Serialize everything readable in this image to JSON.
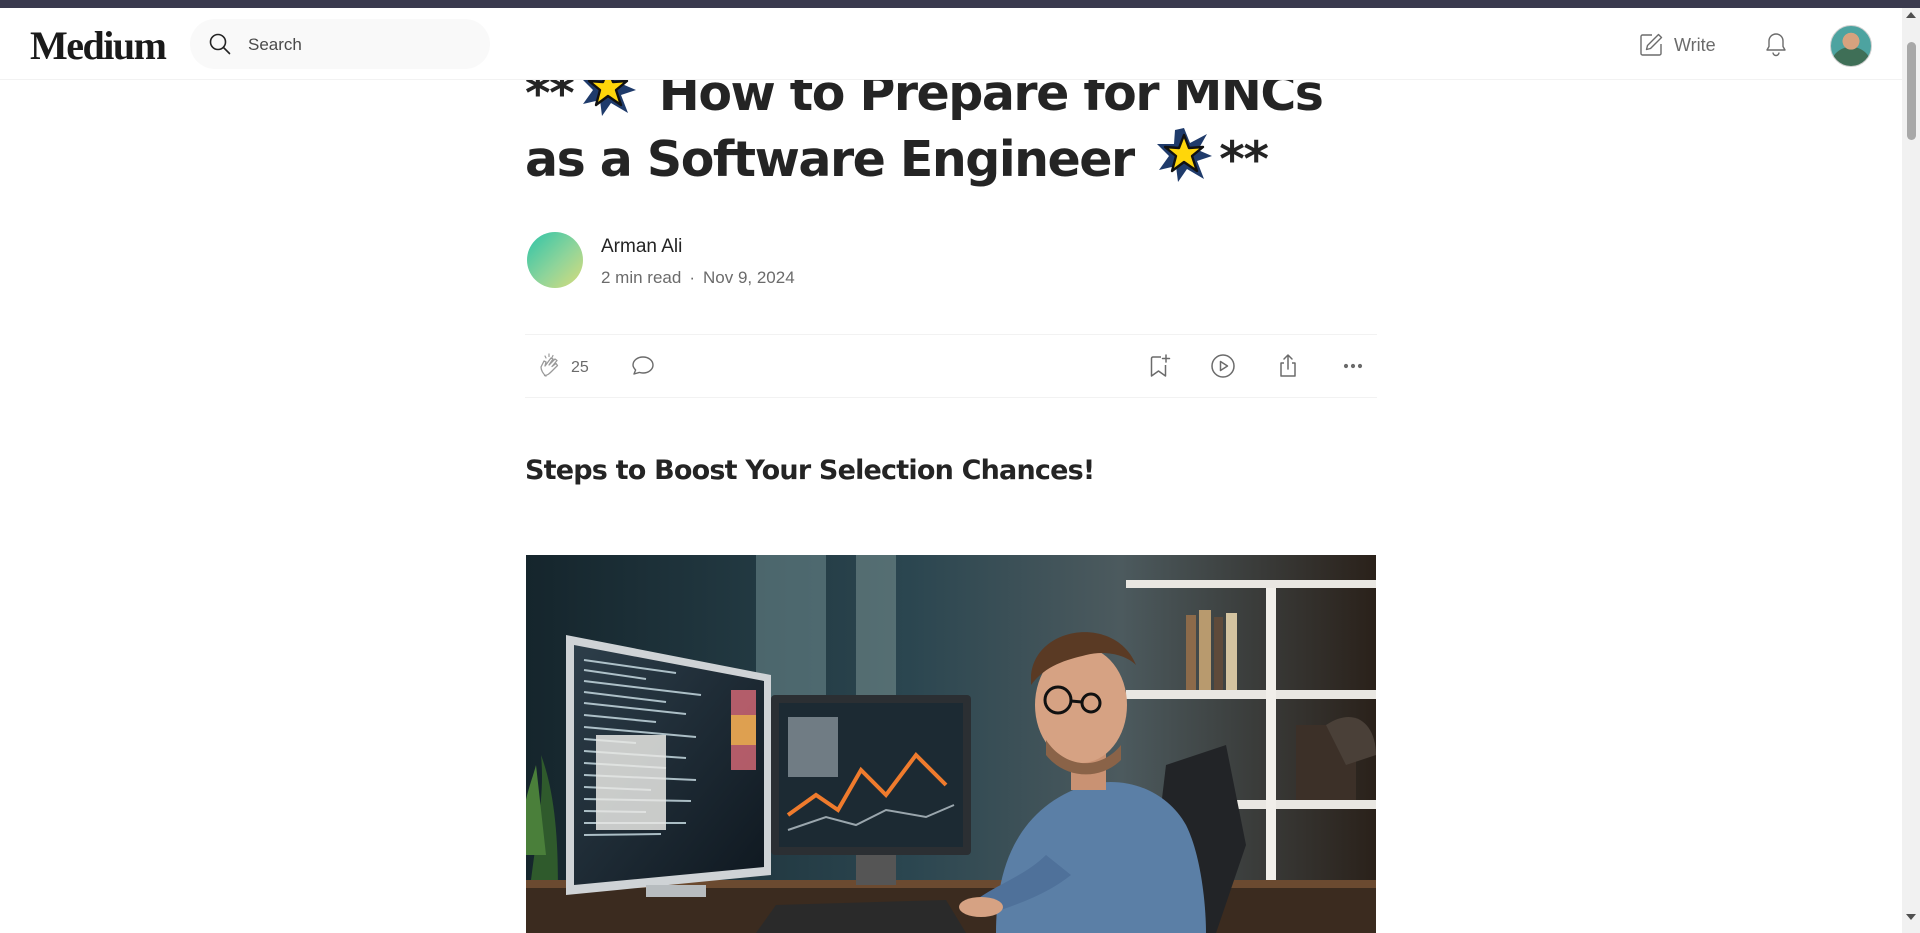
{
  "header": {
    "logo": "Medium",
    "search_placeholder": "Search",
    "write_label": "Write",
    "icons": {
      "search": "search-icon",
      "write": "write-icon",
      "notifications": "bell-icon",
      "avatar": "user-avatar"
    }
  },
  "article": {
    "title_prefix": "**",
    "title_text": "How to Prepare for MNCs as a Software Engineer",
    "title_suffix": "**",
    "title_emoji": "glowing-star",
    "author": "Arman Ali",
    "read_time": "2 min read",
    "separator": "·",
    "date": "Nov 9, 2024",
    "claps": "25",
    "subtitle": "Steps to Boost Your Selection Chances!",
    "hero_image": "software engineer working at multiple monitors with code and charts"
  },
  "actions": {
    "icons": [
      "clap-icon",
      "comment-icon",
      "bookmark-icon",
      "listen-icon",
      "share-icon",
      "more-icon"
    ]
  },
  "colors": {
    "text": "#242424",
    "muted": "#6b6b6b",
    "top_strip": "#3a3a4e",
    "star_fill": "#ffd60a"
  }
}
